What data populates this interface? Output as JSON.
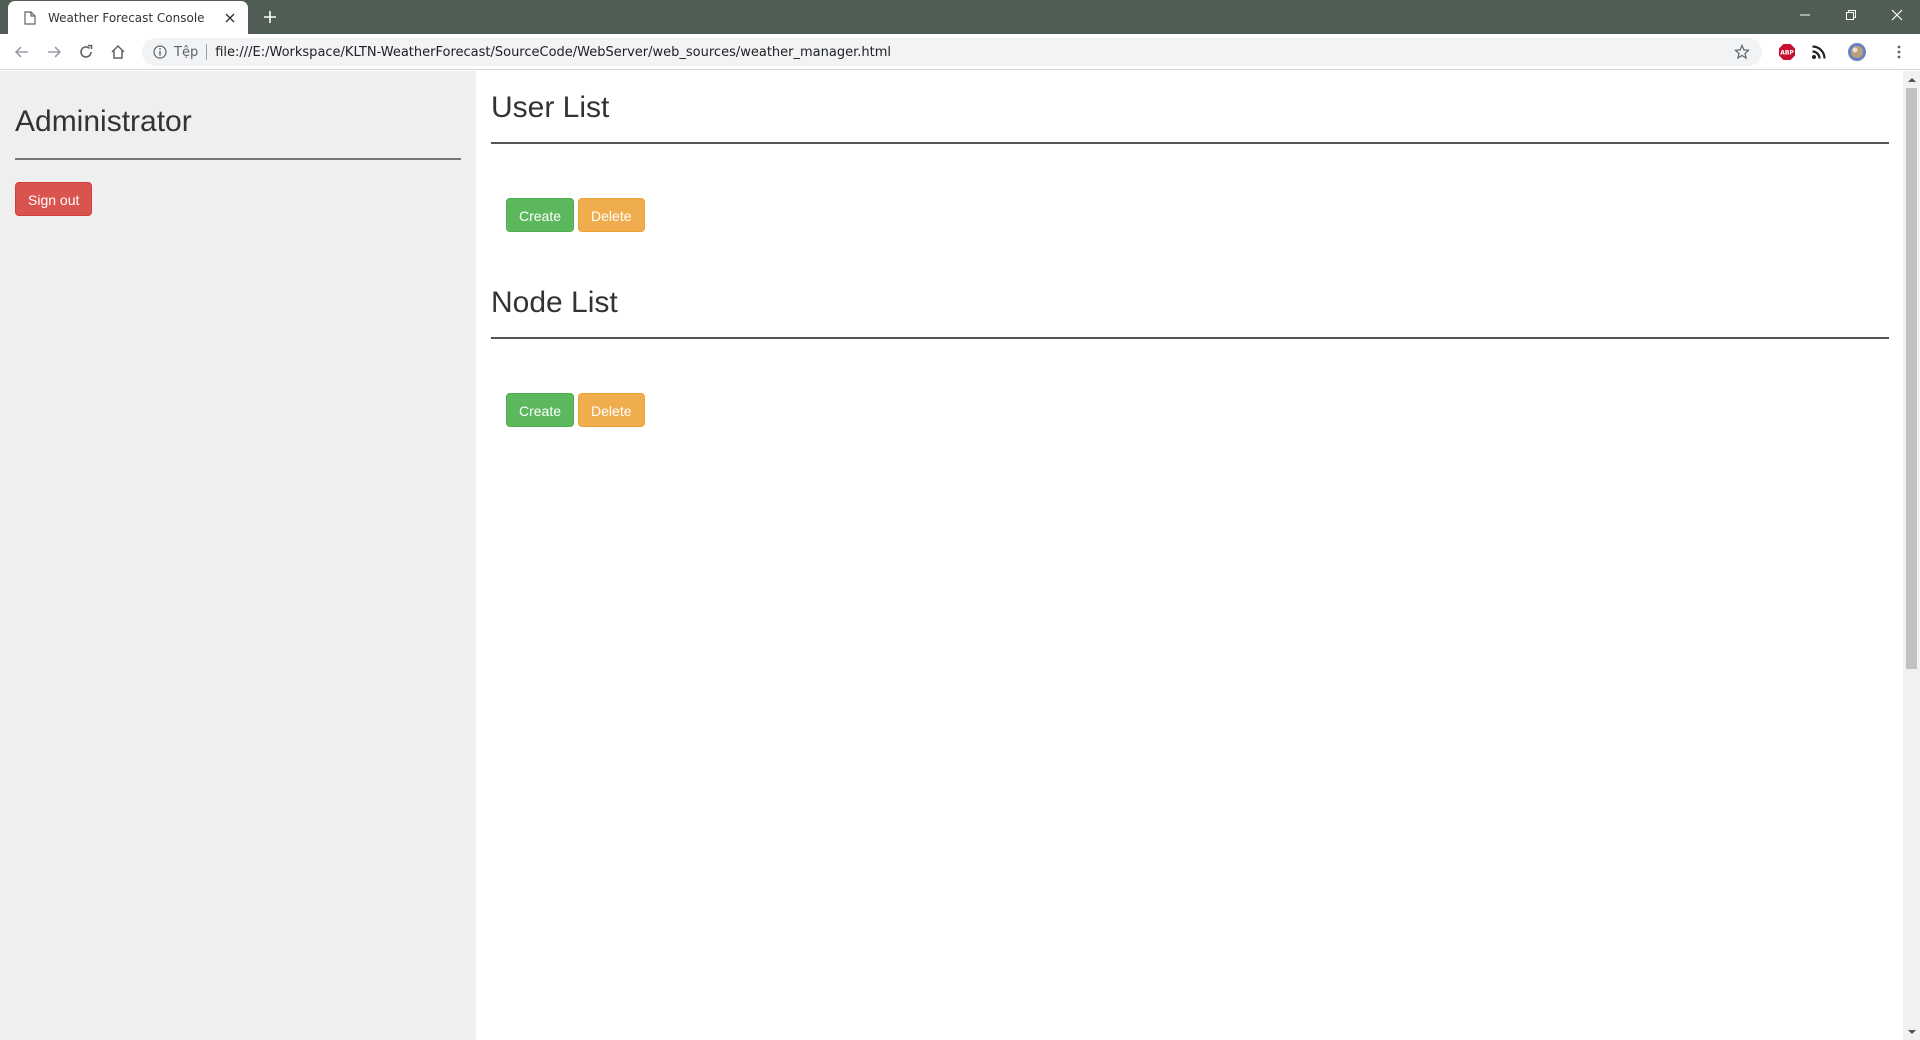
{
  "browser": {
    "tab_title": "Weather Forecast Console",
    "address_scheme_label": "Tệp",
    "address_url": "file:///E:/Workspace/KLTN-WeatherForecast/SourceCode/WebServer/web_sources/weather_manager.html",
    "theme_color": "#4f5d55",
    "extensions": [
      "adblock-icon",
      "rss-icon",
      "profile-avatar"
    ]
  },
  "sidebar": {
    "title": "Administrator",
    "sign_out_label": "Sign out"
  },
  "main": {
    "user_section": {
      "title": "User List",
      "create_label": "Create",
      "delete_label": "Delete"
    },
    "node_section": {
      "title": "Node List",
      "create_label": "Create",
      "delete_label": "Delete"
    }
  },
  "colors": {
    "danger": "#d9534f",
    "success": "#5cb85c",
    "warning": "#f0ad4e",
    "sidebar_bg": "#efefef"
  }
}
